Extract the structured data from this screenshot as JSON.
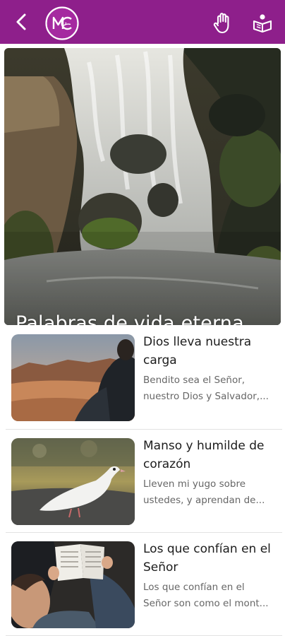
{
  "hero": {
    "title": "Palabras de vida eterna",
    "slides": 3,
    "active_slide": 1
  },
  "articles": [
    {
      "title_lines": [
        "Dios lleva nuestra",
        "carga"
      ],
      "excerpt_lines": [
        "Bendito sea el Señor,",
        "nuestro Dios y Salvador,..."
      ]
    },
    {
      "title_lines": [
        "Manso y humilde de",
        "corazón"
      ],
      "excerpt_lines": [
        "Lleven mi yugo sobre",
        "ustedes, y aprendan de..."
      ]
    },
    {
      "title_lines": [
        "Los que confían en el",
        "Señor"
      ],
      "excerpt_lines": [
        "Los que confían en el",
        "Señor son como el mont..."
      ]
    }
  ],
  "colors": {
    "brand": "#8e1f8b",
    "title": "#1c1c1c",
    "excerpt": "#666666"
  },
  "icons": {
    "back": "chevron-left-icon",
    "logo": "mc-logo",
    "prayer": "hand-icon",
    "bible": "bible-icon"
  }
}
